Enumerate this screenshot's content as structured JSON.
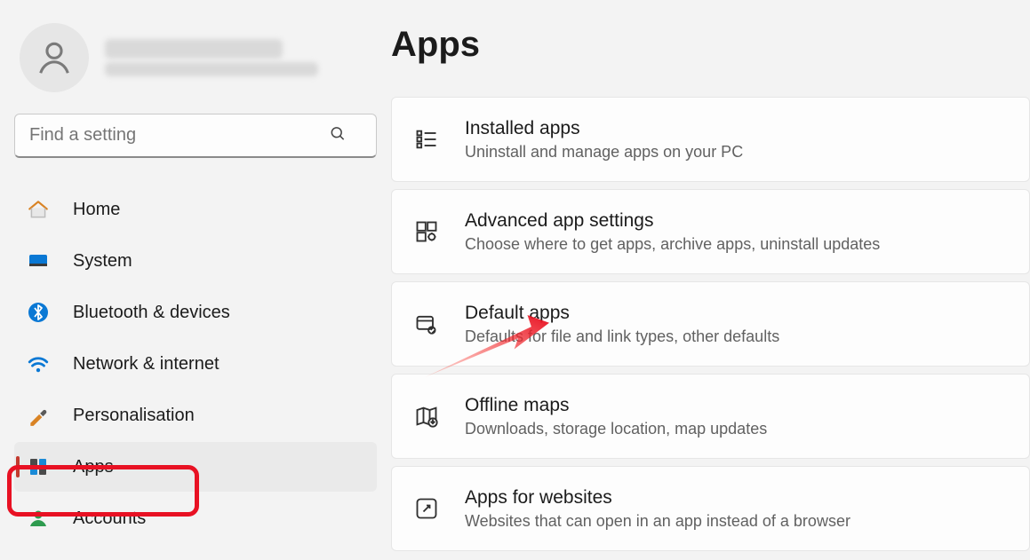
{
  "account": {
    "name_redacted": true,
    "email_redacted": true
  },
  "search": {
    "placeholder": "Find a setting"
  },
  "sidebar": {
    "items": [
      {
        "label": "Home"
      },
      {
        "label": "System"
      },
      {
        "label": "Bluetooth & devices"
      },
      {
        "label": "Network & internet"
      },
      {
        "label": "Personalisation"
      },
      {
        "label": "Apps",
        "selected": true
      },
      {
        "label": "Accounts"
      }
    ]
  },
  "page": {
    "title": "Apps",
    "cards": [
      {
        "title": "Installed apps",
        "desc": "Uninstall and manage apps on your PC"
      },
      {
        "title": "Advanced app settings",
        "desc": "Choose where to get apps, archive apps, uninstall updates"
      },
      {
        "title": "Default apps",
        "desc": "Defaults for file and link types, other defaults"
      },
      {
        "title": "Offline maps",
        "desc": "Downloads, storage location, map updates"
      },
      {
        "title": "Apps for websites",
        "desc": "Websites that can open in an app instead of a browser"
      }
    ]
  },
  "annotations": {
    "highlight_target": "Apps",
    "arrow_target": "Default apps"
  }
}
